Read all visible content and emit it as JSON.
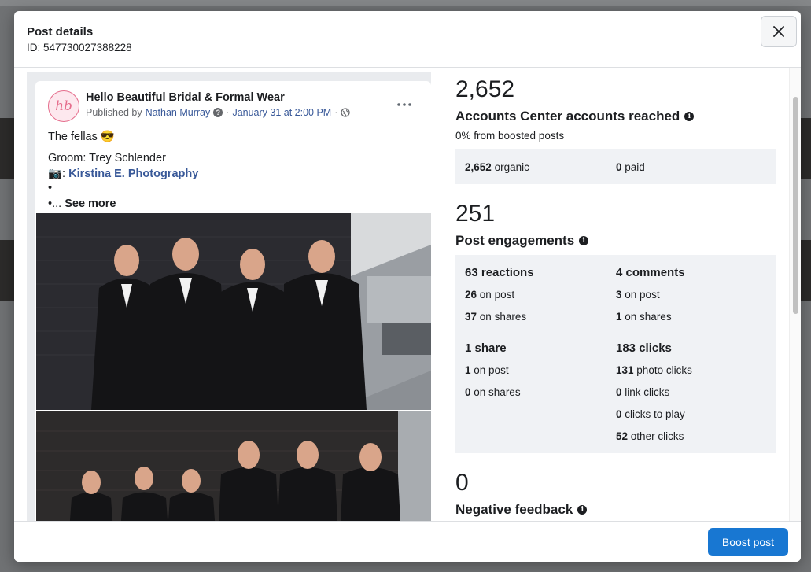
{
  "modal": {
    "title": "Post details",
    "id_text": "ID: 547730027388228",
    "close_icon": "close-icon"
  },
  "post": {
    "page_name": "Hello Beautiful Bridal & Formal Wear",
    "avatar_text": "hb",
    "published_by_prefix": "Published by",
    "author": "Nathan Murray",
    "date": "January 31 at 2:00 PM",
    "separator": "·",
    "lines": {
      "line1": "The fellas 😎",
      "groom": "Groom: Trey Schlender",
      "photo_prefix": "📷:",
      "photographer": "Kirstina E. Photography",
      "dot1": "•",
      "dot2": "•...",
      "see_more": "See more"
    }
  },
  "reach": {
    "value": "2,652",
    "title": "Accounts Center accounts reached",
    "subtitle": "0% from boosted posts",
    "organic_value": "2,652",
    "organic_label": "organic",
    "paid_value": "0",
    "paid_label": "paid"
  },
  "engagements": {
    "value": "251",
    "title": "Post engagements",
    "reactions": {
      "head": "63 reactions",
      "on_post_value": "26",
      "on_post_label": "on post",
      "on_shares_value": "37",
      "on_shares_label": "on shares"
    },
    "comments": {
      "head": "4 comments",
      "on_post_value": "3",
      "on_post_label": "on post",
      "on_shares_value": "1",
      "on_shares_label": "on shares"
    },
    "shares": {
      "head": "1 share",
      "on_post_value": "1",
      "on_post_label": "on post",
      "on_shares_value": "0",
      "on_shares_label": "on shares"
    },
    "clicks": {
      "head": "183 clicks",
      "photo_value": "131",
      "photo_label": "photo clicks",
      "link_value": "0",
      "link_label": "link clicks",
      "play_value": "0",
      "play_label": "clicks to play",
      "other_value": "52",
      "other_label": "other clicks"
    }
  },
  "negative": {
    "value": "0",
    "title": "Negative feedback"
  },
  "footer": {
    "boost_label": "Boost post"
  },
  "colors": {
    "accent": "#1877d2",
    "link": "#385898",
    "panel": "#f0f2f5"
  }
}
